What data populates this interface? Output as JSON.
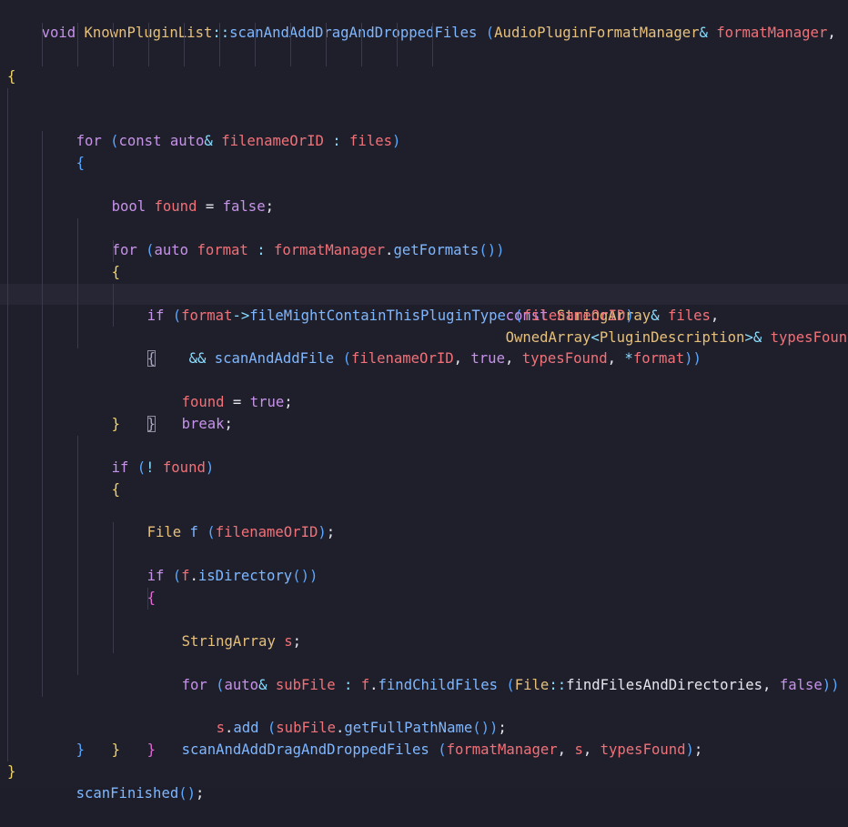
{
  "editor": {
    "lines": [
      [
        "void KnownPluginList::scanAndAddDragAndDroppedFiles (AudioPluginFormatManager& formatManager,"
      ],
      [
        "const StringArray& files,"
      ],
      [
        "OwnedArray<PluginDescription>& typesFound)"
      ],
      [
        "{"
      ],
      [
        "for (const auto& filenameOrID : files)"
      ],
      [
        "{"
      ],
      [
        "bool found = false;"
      ],
      [
        ""
      ],
      [
        "for (auto format : formatManager.getFormats())"
      ],
      [
        "{"
      ],
      [
        "if (format->fileMightContainThisPluginType (filenameOrID)"
      ],
      [
        "&& scanAndAddFile (filenameOrID, true, typesFound, *format))"
      ],
      [
        "{"
      ],
      [
        "found = true;"
      ],
      [
        "break;"
      ],
      [
        "}"
      ],
      [
        "}"
      ],
      [
        ""
      ],
      [
        "if (! found)"
      ],
      [
        "{"
      ],
      [
        "File f (filenameOrID);"
      ],
      [
        ""
      ],
      [
        "if (f.isDirectory())"
      ],
      [
        "{"
      ],
      [
        "StringArray s;"
      ],
      [
        ""
      ],
      [
        "for (auto& subFile : f.findChildFiles (File::findFilesAndDirectories, false))"
      ],
      [
        "s.add (subFile.getFullPathName());"
      ],
      [
        ""
      ],
      [
        "scanAndAddDragAndDroppedFiles (formatManager, s, typesFound);"
      ],
      [
        "}"
      ],
      [
        "}"
      ],
      [
        "}"
      ],
      [
        ""
      ],
      [
        "scanFinished();"
      ],
      [
        "}"
      ]
    ]
  },
  "colors": {
    "background": "#1f1f2b",
    "keyword": "#c792ea",
    "type": "#e6c07b",
    "function": "#7fb7ff",
    "parameter": "#f07178",
    "text": "#e6e6ee"
  }
}
